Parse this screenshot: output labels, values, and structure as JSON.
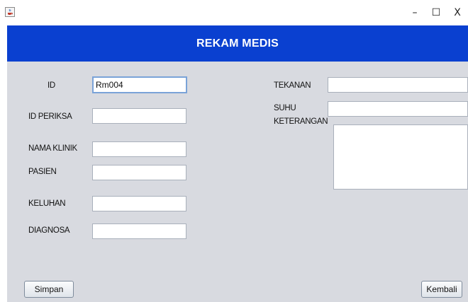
{
  "window": {
    "minimize_glyph": "–",
    "maximize_glyph": "☐",
    "close_glyph": "X",
    "app_icon": "java-coffee-cup-icon"
  },
  "header": {
    "title": "REKAM MEDIS",
    "background": "#0a40d0"
  },
  "form": {
    "id_label": "ID",
    "id_value": "Rm004",
    "id_periksa_label": "ID PERIKSA",
    "id_periksa_value": "",
    "nama_klinik_label": "NAMA KLINIK",
    "nama_klinik_value": "",
    "pasien_label": "PASIEN",
    "pasien_value": "",
    "keluhan_label": "KELUHAN",
    "keluhan_value": "",
    "diagnosa_label": "DIAGNOSA",
    "diagnosa_value": "",
    "tekanan_label": "TEKANAN",
    "tekanan_value": "",
    "suhu_label": "SUHU",
    "suhu_value": "",
    "keterangan_label": "KETERANGAN",
    "keterangan_value": ""
  },
  "buttons": {
    "simpan": "Simpan",
    "kembali": "Kembali"
  }
}
